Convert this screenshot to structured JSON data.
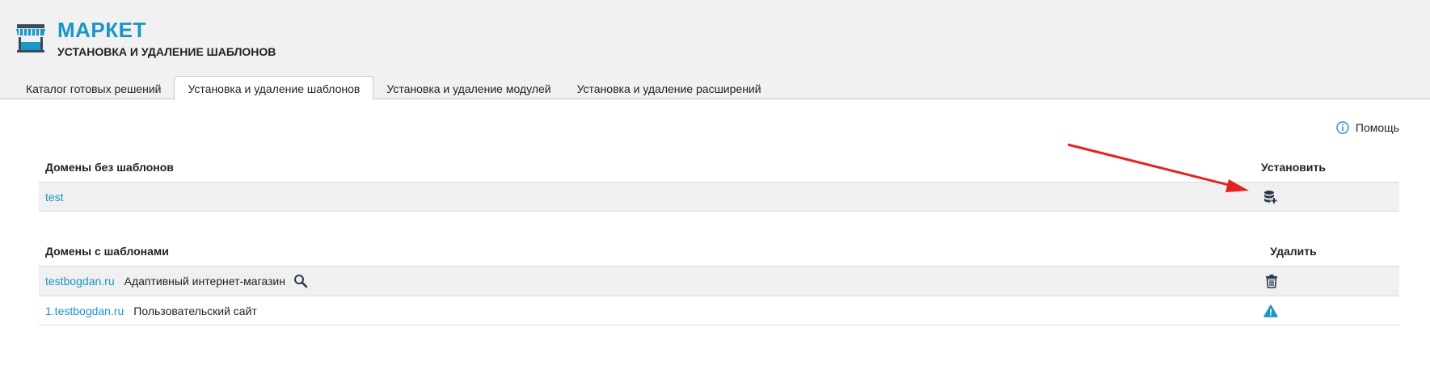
{
  "header": {
    "title": "МАРКЕТ",
    "subtitle": "УСТАНОВКА И УДАЛЕНИЕ ШАБЛОНОВ",
    "logo_icon": "market-stall-icon"
  },
  "tabs": [
    {
      "label": "Каталог готовых решений",
      "active": false
    },
    {
      "label": "Установка и удаление шаблонов",
      "active": true
    },
    {
      "label": "Установка и удаление модулей",
      "active": false
    },
    {
      "label": "Установка и удаление расширений",
      "active": false
    }
  ],
  "help": {
    "label": "Помощь",
    "icon": "info-icon"
  },
  "no_templates": {
    "heading": "Домены без шаблонов",
    "action_heading": "Установить",
    "rows": [
      {
        "domain": "test",
        "action_icon": "database-add-icon"
      }
    ]
  },
  "with_templates": {
    "heading": "Домены с шаблонами",
    "action_heading": "Удалить",
    "rows": [
      {
        "domain": "testbogdan.ru",
        "template": "Адаптивный интернет-магазин",
        "preview_icon": "search-icon",
        "action_icon": "trash-icon"
      },
      {
        "domain": "1.testbogdan.ru",
        "template": "Пользовательский сайт",
        "action_icon": "warning-icon"
      }
    ]
  },
  "colors": {
    "accent": "#1a96c7",
    "arrow": "#e32222",
    "header_bg": "#f1f1f1",
    "row_bg": "#f0f0f0"
  }
}
